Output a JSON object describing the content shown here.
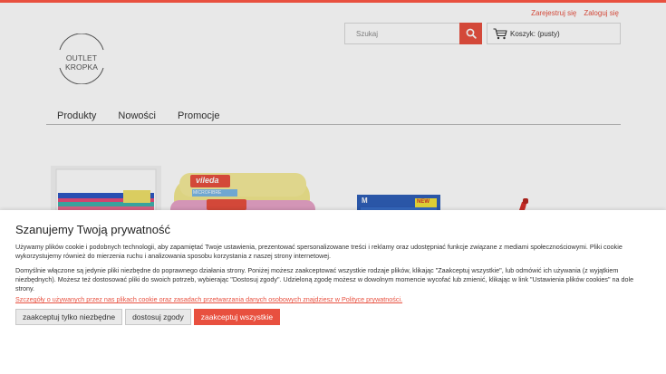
{
  "header": {
    "register": "Zarejestruj się",
    "login": "Zaloguj się",
    "search_placeholder": "Szukaj",
    "cart_label": "Koszyk: (pusty)",
    "logo_text": "OUTLET KROPKA"
  },
  "nav": {
    "items": [
      "Produkty",
      "Nowości",
      "Promocje"
    ]
  },
  "products": {
    "brand": "vileda",
    "size_tag": "M",
    "new_tag": "NEW",
    "microfibre_tag": "MICROFIBRE"
  },
  "cookie": {
    "title": "Szanujemy Twoją prywatność",
    "p1": "Używamy plików cookie i podobnych technologii, aby zapamiętać Twoje ustawienia, prezentować spersonalizowane treści i reklamy oraz udostępniać funkcje związane z mediami społecznościowymi. Pliki cookie wykorzystujemy również do mierzenia ruchu i analizowania sposobu korzystania z naszej strony internetowej.",
    "p2": "Domyślnie włączone są jedynie pliki niezbędne do poprawnego działania strony. Poniżej możesz zaakceptować wszystkie rodzaje plików, klikając \"Zaakceptuj wszystkie\", lub odmówić ich używania (z wyjątkiem niezbędnych). Możesz też dostosować pliki do swoich potrzeb, wybierając \"Dostosuj zgody\". Udzieloną zgodę możesz w dowolnym momencie wycofać lub zmienić, klikając w link \"Ustawienia plików cookies\" na dole strony.",
    "link": "Szczegóły o używanych przez nas plikach cookie oraz zasadach przetwarzania danych osobowych znajdziesz w Polityce prywatności.",
    "btn_necessary": "zaakceptuj tylko niezbędne",
    "btn_customize": "dostosuj zgody",
    "btn_accept_all": "zaakceptuj wszystkie"
  },
  "colors": {
    "accent": "#e8503f"
  }
}
